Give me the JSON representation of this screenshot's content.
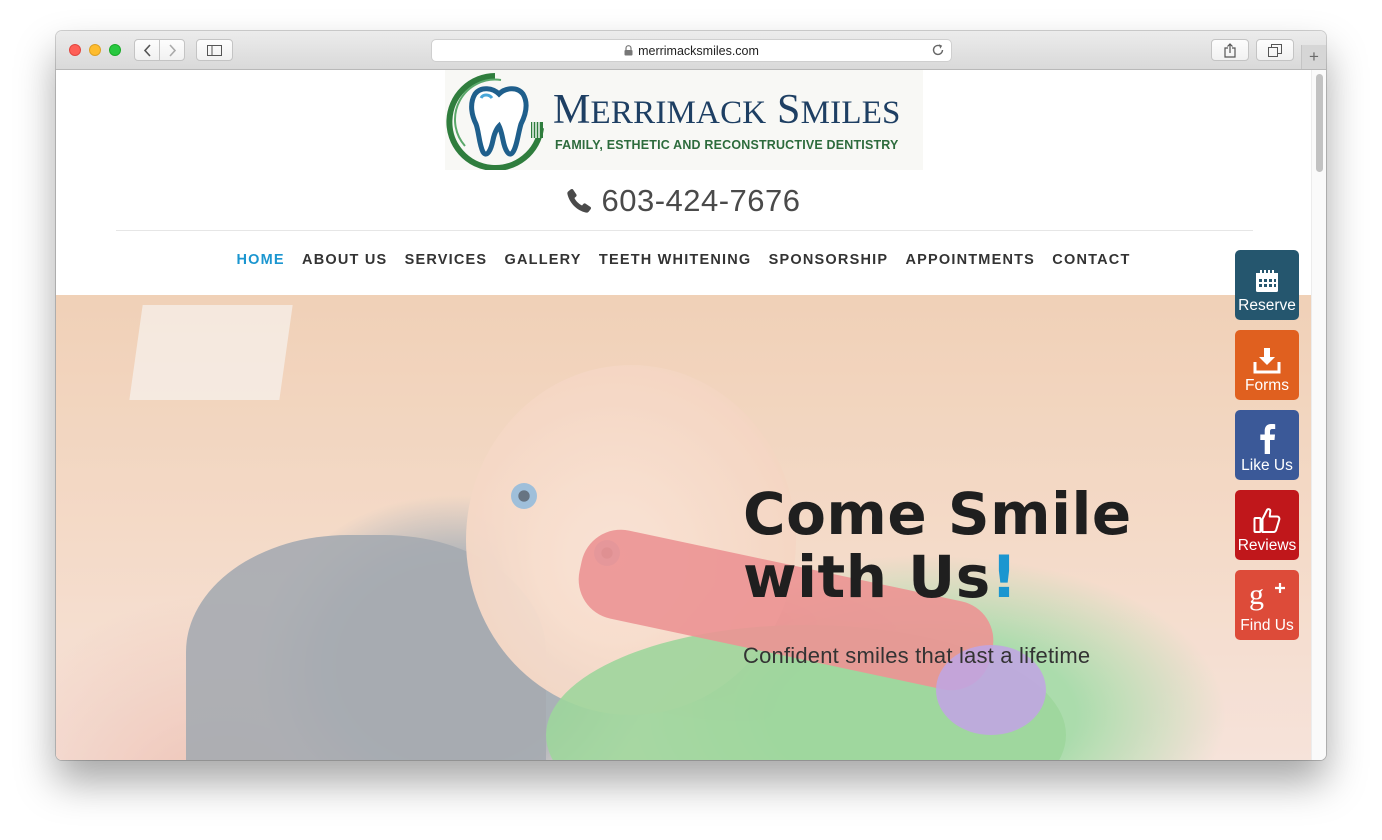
{
  "browser": {
    "url": "merrimacksmiles.com",
    "new_tab_symbol": "+"
  },
  "logo": {
    "brand_first_big": "M",
    "brand_first_rest": "ERRIMACK",
    "brand_second_big": "S",
    "brand_second_rest": "MILES",
    "tagline": "FAMILY, ESTHETIC AND RECONSTRUCTIVE DENTISTRY"
  },
  "phone": "603-424-7676",
  "nav": {
    "items": [
      "HOME",
      "ABOUT US",
      "SERVICES",
      "GALLERY",
      "TEETH WHITENING",
      "SPONSORSHIP",
      "APPOINTMENTS",
      "CONTACT"
    ],
    "active": "HOME"
  },
  "hero": {
    "headline_line1": "Come Smile",
    "headline_line2": "with Us",
    "headline_punct": "!",
    "subheadline": "Confident smiles that last a lifetime"
  },
  "widgets": {
    "reserve": {
      "label": "Reserve",
      "icon": "calendar-icon",
      "color": "#25566e"
    },
    "forms": {
      "label": "Forms",
      "icon": "download-icon",
      "color": "#e0601f"
    },
    "like": {
      "label": "Like Us",
      "icon": "facebook-icon",
      "color": "#3b5998"
    },
    "reviews": {
      "label": "Reviews",
      "icon": "thumbs-up-icon",
      "color": "#c0171b"
    },
    "find": {
      "label": "Find Us",
      "icon": "google-plus-icon",
      "color": "#dd4b39"
    }
  },
  "colors": {
    "accent": "#1b96d0",
    "text_dark": "#1f1f1f"
  }
}
